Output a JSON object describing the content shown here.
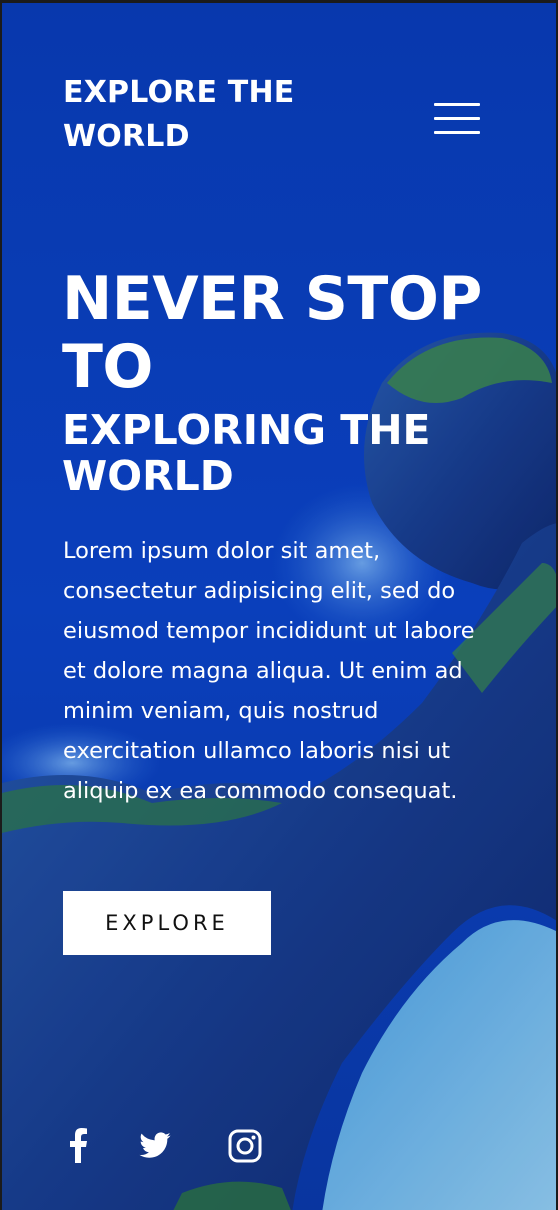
{
  "brand": {
    "line1": "EXPLORE THE",
    "line2": "WORLD"
  },
  "menu": {
    "icon": "hamburger-menu-icon"
  },
  "headline": {
    "line1": "NEVER STOP",
    "line2": "TO",
    "line3": "EXPLORING THE",
    "line4": "WORLD"
  },
  "lead": "Lorem ipsum dolor sit amet, consectetur adipisicing elit, sed do eiusmod tempor incididunt ut labore et dolore magna aliqua. Ut enim ad minim veniam, quis nostrud exercitation ullamco laboris nisi ut aliquip ex ea commodo consequat.",
  "cta": {
    "label": "EXPLORE"
  },
  "social": [
    {
      "icon": "facebook-icon"
    },
    {
      "icon": "twitter-icon"
    },
    {
      "icon": "instagram-icon"
    }
  ],
  "colors": {
    "ocean": "#0b3fc0",
    "ocean_deep": "#062a8a",
    "cliff": "#1d3f8a",
    "vegetation": "#2f7a4a",
    "beach": "#7cc6ee",
    "text": "#ffffff",
    "button_bg": "#ffffff",
    "button_text": "#111111"
  }
}
